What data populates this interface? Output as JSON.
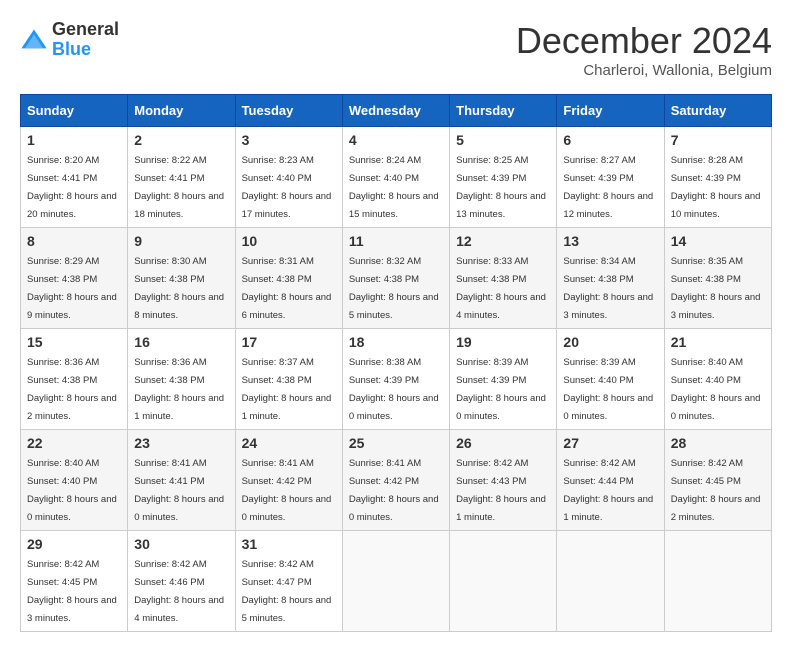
{
  "logo": {
    "general": "General",
    "blue": "Blue"
  },
  "header": {
    "month": "December 2024",
    "location": "Charleroi, Wallonia, Belgium"
  },
  "weekdays": [
    "Sunday",
    "Monday",
    "Tuesday",
    "Wednesday",
    "Thursday",
    "Friday",
    "Saturday"
  ],
  "weeks": [
    [
      {
        "day": "1",
        "sunrise": "8:20 AM",
        "sunset": "4:41 PM",
        "daylight": "8 hours and 20 minutes."
      },
      {
        "day": "2",
        "sunrise": "8:22 AM",
        "sunset": "4:41 PM",
        "daylight": "8 hours and 18 minutes."
      },
      {
        "day": "3",
        "sunrise": "8:23 AM",
        "sunset": "4:40 PM",
        "daylight": "8 hours and 17 minutes."
      },
      {
        "day": "4",
        "sunrise": "8:24 AM",
        "sunset": "4:40 PM",
        "daylight": "8 hours and 15 minutes."
      },
      {
        "day": "5",
        "sunrise": "8:25 AM",
        "sunset": "4:39 PM",
        "daylight": "8 hours and 13 minutes."
      },
      {
        "day": "6",
        "sunrise": "8:27 AM",
        "sunset": "4:39 PM",
        "daylight": "8 hours and 12 minutes."
      },
      {
        "day": "7",
        "sunrise": "8:28 AM",
        "sunset": "4:39 PM",
        "daylight": "8 hours and 10 minutes."
      }
    ],
    [
      {
        "day": "8",
        "sunrise": "8:29 AM",
        "sunset": "4:38 PM",
        "daylight": "8 hours and 9 minutes."
      },
      {
        "day": "9",
        "sunrise": "8:30 AM",
        "sunset": "4:38 PM",
        "daylight": "8 hours and 8 minutes."
      },
      {
        "day": "10",
        "sunrise": "8:31 AM",
        "sunset": "4:38 PM",
        "daylight": "8 hours and 6 minutes."
      },
      {
        "day": "11",
        "sunrise": "8:32 AM",
        "sunset": "4:38 PM",
        "daylight": "8 hours and 5 minutes."
      },
      {
        "day": "12",
        "sunrise": "8:33 AM",
        "sunset": "4:38 PM",
        "daylight": "8 hours and 4 minutes."
      },
      {
        "day": "13",
        "sunrise": "8:34 AM",
        "sunset": "4:38 PM",
        "daylight": "8 hours and 3 minutes."
      },
      {
        "day": "14",
        "sunrise": "8:35 AM",
        "sunset": "4:38 PM",
        "daylight": "8 hours and 3 minutes."
      }
    ],
    [
      {
        "day": "15",
        "sunrise": "8:36 AM",
        "sunset": "4:38 PM",
        "daylight": "8 hours and 2 minutes."
      },
      {
        "day": "16",
        "sunrise": "8:36 AM",
        "sunset": "4:38 PM",
        "daylight": "8 hours and 1 minute."
      },
      {
        "day": "17",
        "sunrise": "8:37 AM",
        "sunset": "4:38 PM",
        "daylight": "8 hours and 1 minute."
      },
      {
        "day": "18",
        "sunrise": "8:38 AM",
        "sunset": "4:39 PM",
        "daylight": "8 hours and 0 minutes."
      },
      {
        "day": "19",
        "sunrise": "8:39 AM",
        "sunset": "4:39 PM",
        "daylight": "8 hours and 0 minutes."
      },
      {
        "day": "20",
        "sunrise": "8:39 AM",
        "sunset": "4:40 PM",
        "daylight": "8 hours and 0 minutes."
      },
      {
        "day": "21",
        "sunrise": "8:40 AM",
        "sunset": "4:40 PM",
        "daylight": "8 hours and 0 minutes."
      }
    ],
    [
      {
        "day": "22",
        "sunrise": "8:40 AM",
        "sunset": "4:40 PM",
        "daylight": "8 hours and 0 minutes."
      },
      {
        "day": "23",
        "sunrise": "8:41 AM",
        "sunset": "4:41 PM",
        "daylight": "8 hours and 0 minutes."
      },
      {
        "day": "24",
        "sunrise": "8:41 AM",
        "sunset": "4:42 PM",
        "daylight": "8 hours and 0 minutes."
      },
      {
        "day": "25",
        "sunrise": "8:41 AM",
        "sunset": "4:42 PM",
        "daylight": "8 hours and 0 minutes."
      },
      {
        "day": "26",
        "sunrise": "8:42 AM",
        "sunset": "4:43 PM",
        "daylight": "8 hours and 1 minute."
      },
      {
        "day": "27",
        "sunrise": "8:42 AM",
        "sunset": "4:44 PM",
        "daylight": "8 hours and 1 minute."
      },
      {
        "day": "28",
        "sunrise": "8:42 AM",
        "sunset": "4:45 PM",
        "daylight": "8 hours and 2 minutes."
      }
    ],
    [
      {
        "day": "29",
        "sunrise": "8:42 AM",
        "sunset": "4:45 PM",
        "daylight": "8 hours and 3 minutes."
      },
      {
        "day": "30",
        "sunrise": "8:42 AM",
        "sunset": "4:46 PM",
        "daylight": "8 hours and 4 minutes."
      },
      {
        "day": "31",
        "sunrise": "8:42 AM",
        "sunset": "4:47 PM",
        "daylight": "8 hours and 5 minutes."
      },
      null,
      null,
      null,
      null
    ]
  ]
}
